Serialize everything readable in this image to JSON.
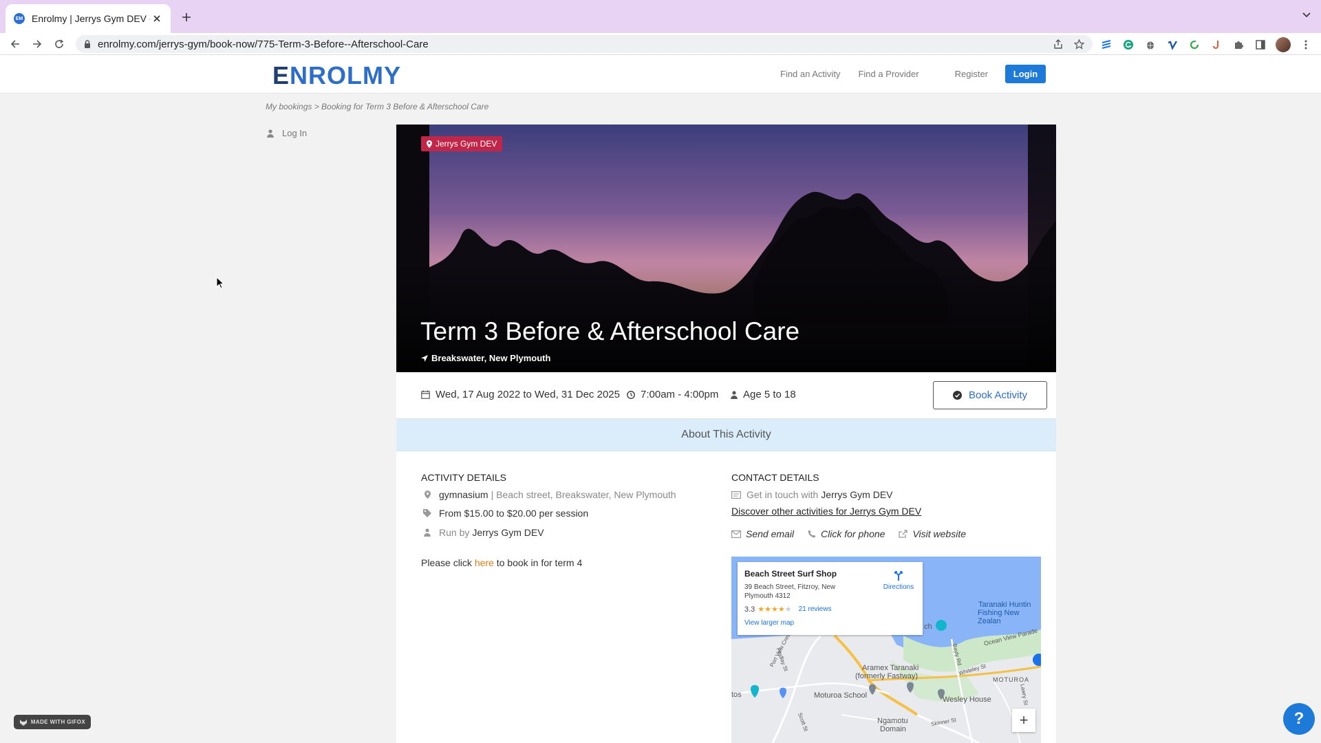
{
  "browser": {
    "tab_title": "Enrolmy | Jerrys Gym DEV - Bo",
    "favicon_text": "EM",
    "url": "enrolmy.com/jerrys-gym/book-now/775-Term-3-Before--Afterschool-Care"
  },
  "header": {
    "logo": "NROLMY",
    "logo_e": "E",
    "nav": {
      "find_activity": "Find an Activity",
      "find_provider": "Find a Provider",
      "register": "Register",
      "login": "Login"
    }
  },
  "breadcrumb": "My bookings > Booking for Term 3 Before & Afterschool Care",
  "sidebar": {
    "login": "Log In"
  },
  "hero": {
    "provider_tag": "Jerrys Gym DEV",
    "title": "Term 3 Before & Afterschool Care",
    "location": "Breakswater, New Plymouth"
  },
  "info": {
    "dates": "Wed, 17 Aug 2022 to Wed, 31 Dec 2025",
    "time": "7:00am - 4:00pm",
    "age": "Age 5 to 18",
    "book_button": "Book Activity"
  },
  "about_bar": "About This Activity",
  "activity_details": {
    "heading": "ACTIVITY DETAILS",
    "venue": "gymnasium",
    "address": "| Beach street, Breakswater, New Plymouth",
    "price": "From $15.00 to $20.00 per session",
    "run_by_label": "Run by",
    "run_by": "Jerrys Gym DEV",
    "note_prefix": "Please click ",
    "note_link": "here",
    "note_suffix": " to book in for term 4"
  },
  "contact_details": {
    "heading": "CONTACT DETAILS",
    "get_in_touch_label": "Get in touch with",
    "provider": "Jerrys Gym DEV",
    "discover_link": "Discover other activities for Jerrys Gym DEV",
    "send_email": "Send email",
    "phone": "Click for phone",
    "website": "Visit website"
  },
  "map": {
    "place_name": "Beach Street Surf Shop",
    "address": "39 Beach Street, Fitzroy, New Plymouth 4312",
    "rating": "3.3",
    "reviews": "21 reviews",
    "view_larger": "View larger map",
    "directions": "Directions",
    "zoom_in": "+",
    "labels": {
      "aramex": "Aramex Taranaki",
      "fastway": "(formerly Fastway)",
      "moturoa": "Moturoa School",
      "wesley": "Wesley House",
      "moturoa_area": "MOTUROA",
      "taranaki_hunting": "Taranaki Huntin",
      "fishing": "Fishing New Zealan",
      "ocean_view": "Ocean View Parade",
      "ngamotu": "Ngamotu",
      "domain": "Domain",
      "port_view": "Port View Cres",
      "findlay": "Findlay St",
      "whiteley": "Whiteley St",
      "bayly": "Bayly Rd",
      "scott": "Scott St",
      "skinner": "Skinner St",
      "lawry": "Lawry St",
      "tos": "tos",
      "ch": "ch"
    }
  },
  "badges": {
    "gifox": "MADE WITH GIFOX",
    "help": "?"
  },
  "colors": {
    "brand_blue": "#1e7ad8",
    "provider_tag": "#c0254a",
    "about_bar": "#dbecfa",
    "link_orange": "#e07c19",
    "tab_bar": "#e8d3f5"
  }
}
